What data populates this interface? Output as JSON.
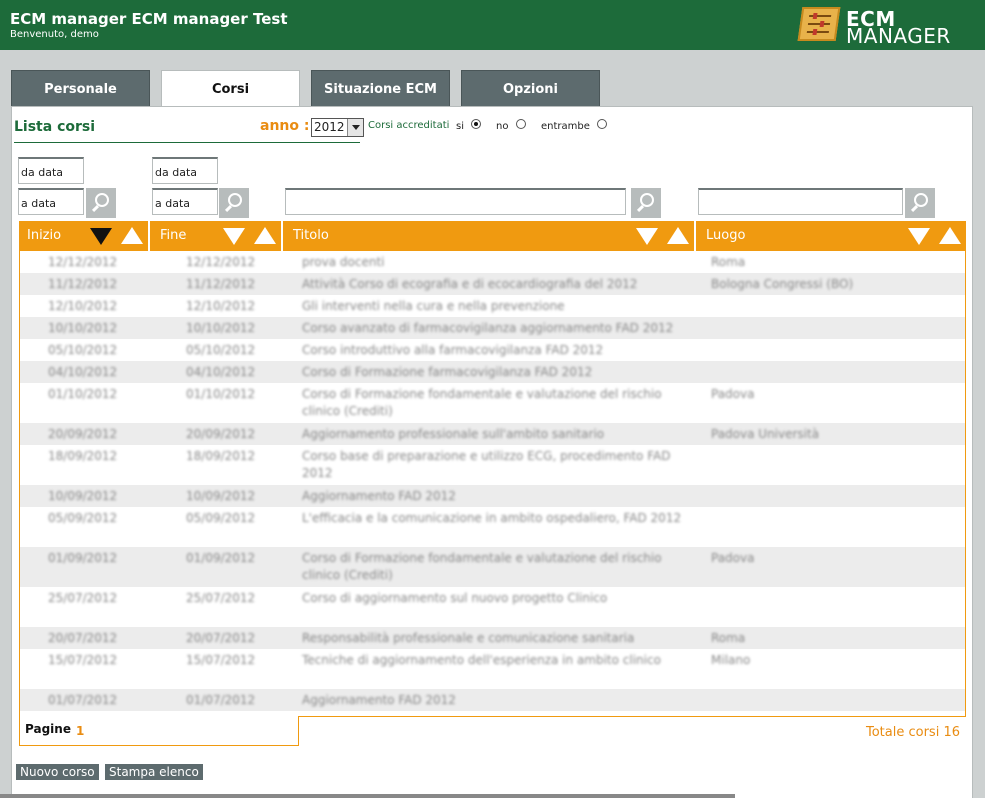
{
  "header": {
    "title": "ECM manager ECM manager Test",
    "welcome": "Benvenuto, demo",
    "logo_line1": "ECM",
    "logo_line2": "MANAGER"
  },
  "tabs": [
    {
      "label": "Personale",
      "active": false
    },
    {
      "label": "Corsi",
      "active": true
    },
    {
      "label": "Situazione ECM",
      "active": false
    },
    {
      "label": "Opzioni",
      "active": false
    }
  ],
  "list": {
    "title": "Lista corsi",
    "anno_label": "anno :",
    "anno_value": "2012",
    "accreditati_label": "Corsi accreditati",
    "radio_si": "si",
    "radio_no": "no",
    "radio_entrambe": "entrambe",
    "selected_radio": "si"
  },
  "filters": {
    "inizio_da": "da data",
    "inizio_a": "a data",
    "fine_da": "da data",
    "fine_a": "a data",
    "titolo": "",
    "luogo": ""
  },
  "columns": {
    "inizio": "Inizio",
    "fine": "Fine",
    "titolo": "Titolo",
    "luogo": "Luogo"
  },
  "rows": [
    {
      "inizio": "12/12/2012",
      "fine": "12/12/2012",
      "titolo": "prova docenti",
      "luogo": "Roma"
    },
    {
      "inizio": "11/12/2012",
      "fine": "11/12/2012",
      "titolo": "Attività Corso di ecografia e di ecocardiografia del 2012",
      "luogo": "Bologna Congressi (BO)"
    },
    {
      "inizio": "12/10/2012",
      "fine": "12/10/2012",
      "titolo": "Gli interventi nella cura e nella prevenzione",
      "luogo": ""
    },
    {
      "inizio": "10/10/2012",
      "fine": "10/10/2012",
      "titolo": "Corso avanzato di farmacovigilanza aggiornamento FAD 2012",
      "luogo": ""
    },
    {
      "inizio": "05/10/2012",
      "fine": "05/10/2012",
      "titolo": "Corso introduttivo alla farmacovigilanza FAD 2012",
      "luogo": ""
    },
    {
      "inizio": "04/10/2012",
      "fine": "04/10/2012",
      "titolo": "Corso di Formazione farmacovigilanza FAD 2012",
      "luogo": ""
    },
    {
      "inizio": "01/10/2012",
      "fine": "01/10/2012",
      "titolo": "Corso di Formazione fondamentale e valutazione del rischio clinico (Crediti)",
      "luogo": "Padova"
    },
    {
      "inizio": "20/09/2012",
      "fine": "20/09/2012",
      "titolo": "Aggiornamento professionale sull'ambito sanitario",
      "luogo": "Padova Università"
    },
    {
      "inizio": "18/09/2012",
      "fine": "18/09/2012",
      "titolo": "Corso base di preparazione e utilizzo ECG, procedimento FAD 2012",
      "luogo": ""
    },
    {
      "inizio": "10/09/2012",
      "fine": "10/09/2012",
      "titolo": "Aggiornamento FAD 2012",
      "luogo": ""
    },
    {
      "inizio": "05/09/2012",
      "fine": "05/09/2012",
      "titolo": "L'efficacia e la comunicazione in ambito ospedaliero, FAD 2012",
      "luogo": ""
    },
    {
      "inizio": "01/09/2012",
      "fine": "01/09/2012",
      "titolo": "Corso di Formazione fondamentale e valutazione del rischio clinico (Crediti)",
      "luogo": "Padova"
    },
    {
      "inizio": "25/07/2012",
      "fine": "25/07/2012",
      "titolo": "Corso di aggiornamento sul nuovo progetto Clinico",
      "luogo": ""
    },
    {
      "inizio": "20/07/2012",
      "fine": "20/07/2012",
      "titolo": "Responsabilità professionale e comunicazione sanitaria",
      "luogo": "Roma"
    },
    {
      "inizio": "15/07/2012",
      "fine": "15/07/2012",
      "titolo": "Tecniche di aggiornamento dell'esperienza in ambito clinico",
      "luogo": "Milano"
    },
    {
      "inizio": "01/07/2012",
      "fine": "01/07/2012",
      "titolo": "Aggiornamento FAD 2012",
      "luogo": ""
    }
  ],
  "footer": {
    "pagine_label": "Pagine",
    "pagine_current": "1",
    "totale": "Totale corsi 16"
  },
  "buttons": {
    "nuovo": "Nuovo corso",
    "stampa": "Stampa elenco"
  },
  "colors": {
    "header_green": "#1d6b3a",
    "accent_orange": "#f09a10",
    "tab_gray": "#5d6b6e"
  }
}
